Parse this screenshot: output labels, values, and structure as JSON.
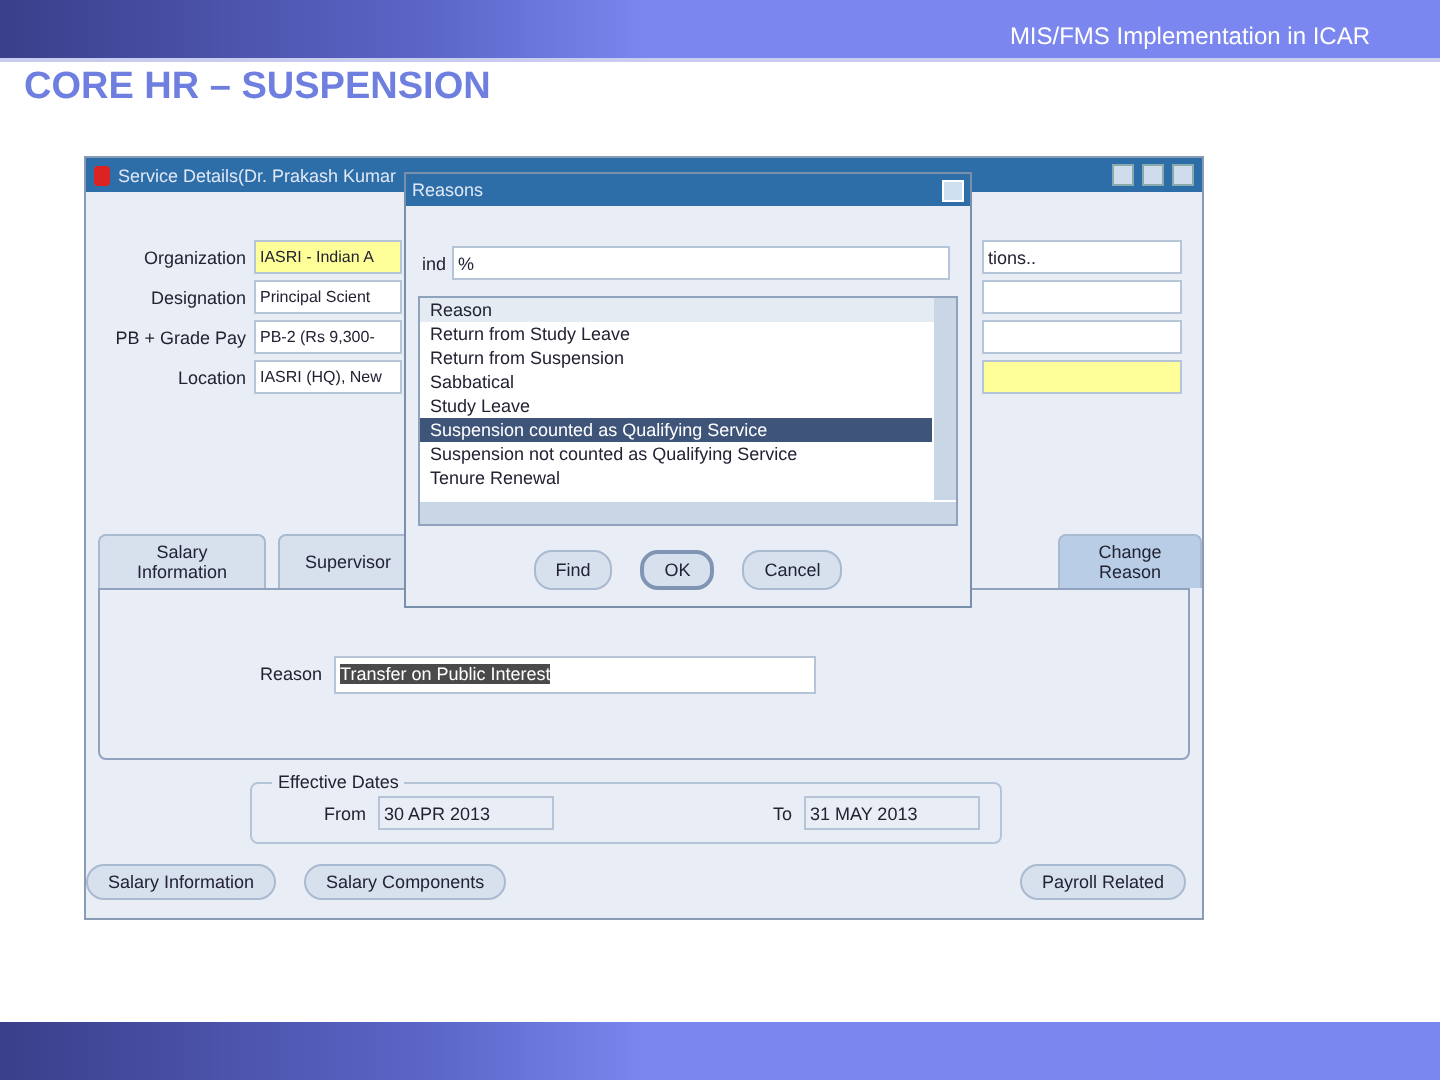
{
  "slide": {
    "header": "MIS/FMS Implementation in ICAR",
    "title": "CORE HR – SUSPENSION"
  },
  "window": {
    "title": "Service Details(Dr. Prakash Kumar",
    "fields": [
      {
        "label": "Organization",
        "value": "IASRI - Indian A",
        "required": true
      },
      {
        "label": "Designation",
        "value": "Principal Scient",
        "required": false
      },
      {
        "label": "PB + Grade Pay",
        "value": "PB-2 (Rs 9,300-",
        "required": false
      },
      {
        "label": "Location",
        "value": "IASRI (HQ), New",
        "required": false
      }
    ],
    "right_fields": [
      {
        "value": "tions..",
        "required": false
      },
      {
        "required": false
      },
      {
        "required": false
      },
      {
        "required": true
      }
    ],
    "tabs": [
      {
        "label": "Salary Information",
        "selected": false
      },
      {
        "label": "Supervisor",
        "selected": false
      },
      {
        "label": "Change Reason",
        "selected": true
      }
    ],
    "reason": {
      "label": "Reason",
      "value": "Transfer on Public Interest"
    },
    "effective_dates": {
      "legend": "Effective Dates",
      "from_label": "From",
      "from": "30 APR 2013",
      "to_label": "To",
      "to": "31 MAY 2013"
    },
    "buttons": [
      "Salary Information",
      "Salary Components",
      "Payroll Related"
    ]
  },
  "dialog": {
    "title": "Reasons",
    "find_label": "ind",
    "find_value": "%",
    "column": "Reason",
    "items": [
      {
        "label": "Return from Study Leave",
        "selected": false
      },
      {
        "label": "Return from Suspension",
        "selected": false
      },
      {
        "label": "Sabbatical",
        "selected": false
      },
      {
        "label": "Study Leave",
        "selected": false
      },
      {
        "label": "Suspension counted as Qualifying Service",
        "selected": true
      },
      {
        "label": "Suspension not counted as Qualifying Service",
        "selected": false
      },
      {
        "label": "Tenure Renewal",
        "selected": false
      }
    ],
    "buttons": [
      {
        "label": "Find",
        "default": false
      },
      {
        "label": "OK",
        "default": true
      },
      {
        "label": "Cancel",
        "default": false
      }
    ]
  }
}
